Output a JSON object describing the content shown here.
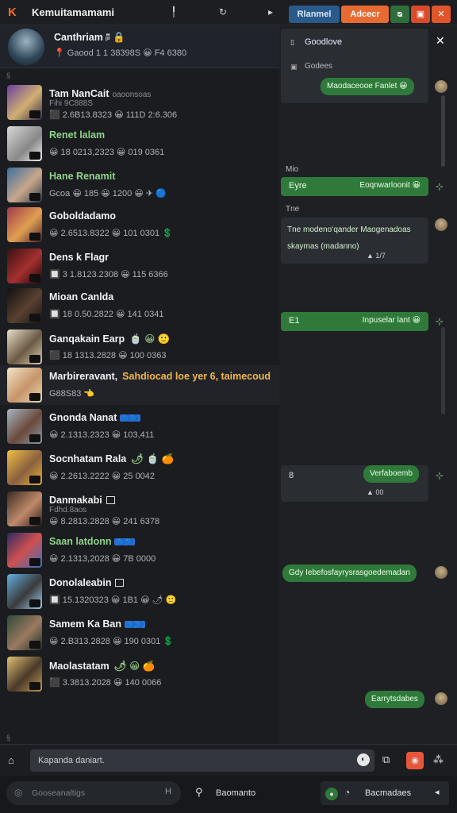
{
  "titlebar": {
    "title": "Kemuitamamami",
    "buttons": [
      "Rlanmel",
      "Adcecr"
    ]
  },
  "pinned": {
    "name": "Canthriam",
    "name_suffix": "🖗 🔒",
    "meta_prefix": "📍",
    "meta": "Gaood 1 1 38398S 😀 F4 6380"
  },
  "sections": [
    "§",
    "§",
    "§"
  ],
  "chats": [
    {
      "name": "Tam NanCait",
      "sub": "oaoonsoas",
      "line2": "Fihi 9C888S",
      "meta": "⬛ 2.6B13.8323 😀 111D 2:6.306"
    },
    {
      "name": "Renet lalam",
      "meta": "😀 18 0213,2323 😀 019 0361",
      "green": true
    },
    {
      "name": "Hane Renamit",
      "meta": "Gcoa 😀 185 😀 1200 😀 ✈ 🔵",
      "green": true
    },
    {
      "name": "Goboldadamo",
      "meta": "😀 2.6513.8322 😀 101 0301 💲"
    },
    {
      "name": "Dens k Flagr",
      "meta": "🔲 3 1.8123.2308 😀 115 6366"
    },
    {
      "name": "Mioan Canlda",
      "meta": "🔲 18 0.50.2822 😀 141 0341"
    },
    {
      "name": "Ganqakain Earp",
      "name_extra": "🍵 😀 🙂",
      "meta": "⬛ 18 1313.2828 😀 100 0363"
    },
    {
      "name": "Marbireravant,",
      "name_extra": "Sahdiocad loe yer 6, taimecoud",
      "meta": "G88S83 👈"
    },
    {
      "name": "Gnonda Nanat",
      "tag": "🔵🔵",
      "meta": "😀 2.1313.2323 😀 103,411"
    },
    {
      "name": "Socnhatam Rala",
      "name_extra": "🌶 🍵 🍊",
      "meta": "😀 2.2613.2222 😀 25 0042"
    },
    {
      "name": "Danmakabi",
      "line2": "Fdhd.8aos",
      "meta": "😀 8.2813.2828 😀 241 6378",
      "sq": true
    },
    {
      "name": "Saan latdonn",
      "tag": "🔵🔵",
      "meta": "😀 2.1313,2028 😀 7B 0000",
      "green": true
    },
    {
      "name": "Donolaleabin",
      "meta": "🔲 15.1320323 😀 1B1 😀 🌶 🙂",
      "sq": true
    },
    {
      "name": "Samem Ka Ban",
      "tag": "🔵🔵",
      "meta": "😀 2.B313.2828 😀 190 0301 💲"
    },
    {
      "name": "Maolastatam",
      "name_extra": "🌶 😀 🍊",
      "meta": "⬛ 3.3813.2028 😀 140 0066"
    }
  ],
  "panel": {
    "title": "Goodlove",
    "subtitle": "Godees",
    "label_mio": "Mio",
    "label_ine": "Tne",
    "messages": [
      {
        "text": "Maodaceooe Fanlet 😀",
        "type": "out"
      },
      {
        "left": "Eyre",
        "text": "Eoqnwarloonit 😀",
        "type": "card"
      },
      {
        "text": "Tne modenoʻqander Maogenadoas skaymas (madanno)",
        "type": "card-long",
        "status": "▲ 1/7"
      },
      {
        "left": "E1",
        "text": "Inpuselar lant 😀",
        "type": "card"
      },
      {
        "left": "8",
        "text": "Verfaboemb",
        "type": "card",
        "status": "▲ 00"
      },
      {
        "text": "Gdy Iebefosfayrysrasgoedemadan",
        "type": "out"
      },
      {
        "text": "Earrytsdabes",
        "type": "out"
      }
    ]
  },
  "composer": {
    "placeholder": "Kapanda daniart."
  },
  "statusbar": {
    "search": "Gooseanaltigs",
    "search_end": "H",
    "mid": "Baomanto",
    "right": "Bacmadaes"
  },
  "colors": {
    "accent_orange": "#e66a32",
    "accent_blue": "#2a5a8a",
    "bubble_green": "#2f7a3a"
  }
}
